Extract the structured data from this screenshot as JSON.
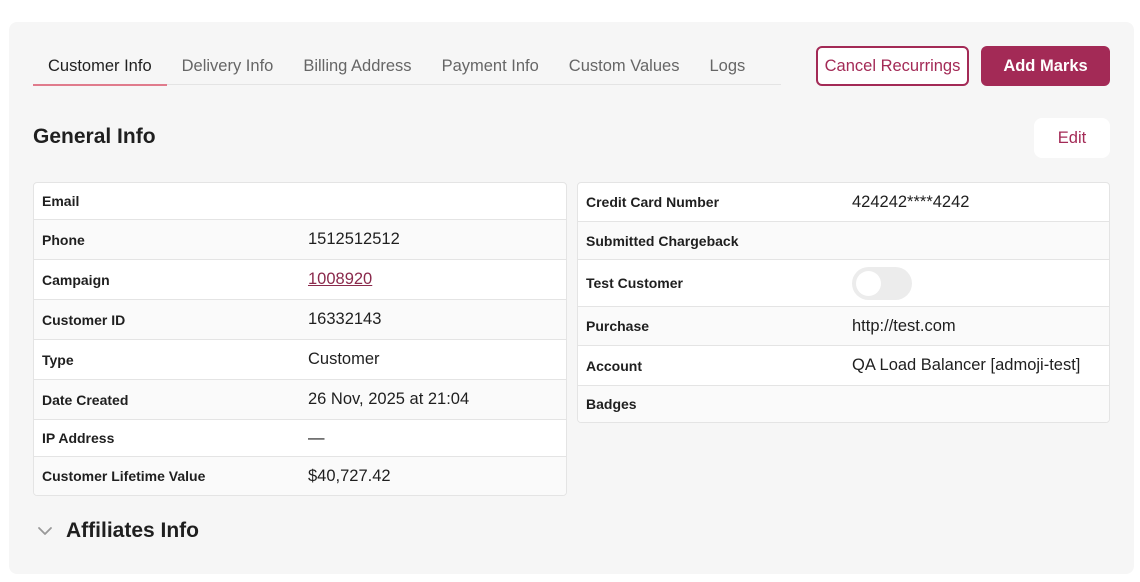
{
  "tabs": [
    {
      "label": "Customer Info",
      "active": true
    },
    {
      "label": "Delivery Info",
      "active": false
    },
    {
      "label": "Billing Address",
      "active": false
    },
    {
      "label": "Payment Info",
      "active": false
    },
    {
      "label": "Custom Values",
      "active": false
    },
    {
      "label": "Logs",
      "active": false
    }
  ],
  "actions": {
    "cancel_recurrings": "Cancel Recurrings",
    "add_marks": "Add Marks",
    "edit": "Edit"
  },
  "general_info": {
    "title": "General Info",
    "left": [
      {
        "label": "Email",
        "value": ""
      },
      {
        "label": "Phone",
        "value": "1512512512"
      },
      {
        "label": "Campaign",
        "value": "1008920"
      },
      {
        "label": "Customer ID",
        "value": "16332143"
      },
      {
        "label": "Type",
        "value": "Customer"
      },
      {
        "label": "Date Created",
        "value": "26 Nov, 2025 at 21:04"
      },
      {
        "label": "IP Address",
        "value": "—"
      },
      {
        "label": "Customer Lifetime Value",
        "value": "$40,727.42"
      }
    ],
    "right": [
      {
        "label": "Credit Card Number",
        "value": "424242****4242"
      },
      {
        "label": "Submitted Chargeback",
        "value": ""
      },
      {
        "label": "Test Customer",
        "toggle": false
      },
      {
        "label": "Purchase",
        "value": "http://test.com"
      },
      {
        "label": "Account",
        "value": "QA Load Balancer [admoji-test]"
      },
      {
        "label": "Badges",
        "value": ""
      }
    ]
  },
  "affiliates": {
    "title": "Affiliates Info",
    "icon": "chevron-down-icon"
  },
  "colors": {
    "accent": "#a32a56",
    "tab_underline": "#e07b8c",
    "panel_bg": "#f6f6f6"
  }
}
